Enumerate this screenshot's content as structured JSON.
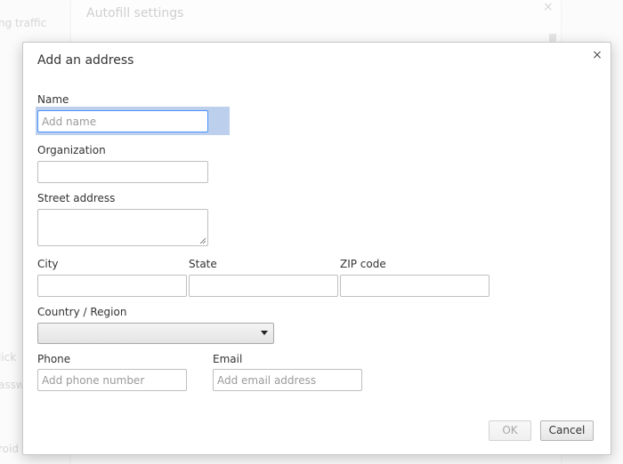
{
  "background": {
    "panel_title": "Autofill settings",
    "close_glyph": "×",
    "fragments": [
      "ng traffic",
      "lick",
      "assw",
      "roid"
    ]
  },
  "dialog": {
    "title": "Add an address",
    "close_glyph": "×",
    "fields": {
      "name": {
        "label": "Name",
        "placeholder": "Add name",
        "value": ""
      },
      "organization": {
        "label": "Organization",
        "value": ""
      },
      "street": {
        "label": "Street address",
        "value": ""
      },
      "city": {
        "label": "City",
        "value": ""
      },
      "state": {
        "label": "State",
        "value": ""
      },
      "zip": {
        "label": "ZIP code",
        "value": ""
      },
      "country": {
        "label": "Country / Region",
        "selected": ""
      },
      "phone": {
        "label": "Phone",
        "placeholder": "Add phone number",
        "value": ""
      },
      "email": {
        "label": "Email",
        "placeholder": "Add email address",
        "value": ""
      }
    },
    "buttons": {
      "ok": "OK",
      "cancel": "Cancel"
    }
  },
  "icons": {
    "close": "close-icon",
    "dropdown": "chevron-down-icon",
    "resize": "resize-grip-icon"
  },
  "colors": {
    "focus_border": "#4d90fe",
    "focus_highlight": "#bcd0ee",
    "placeholder": "#9a9a9a"
  }
}
